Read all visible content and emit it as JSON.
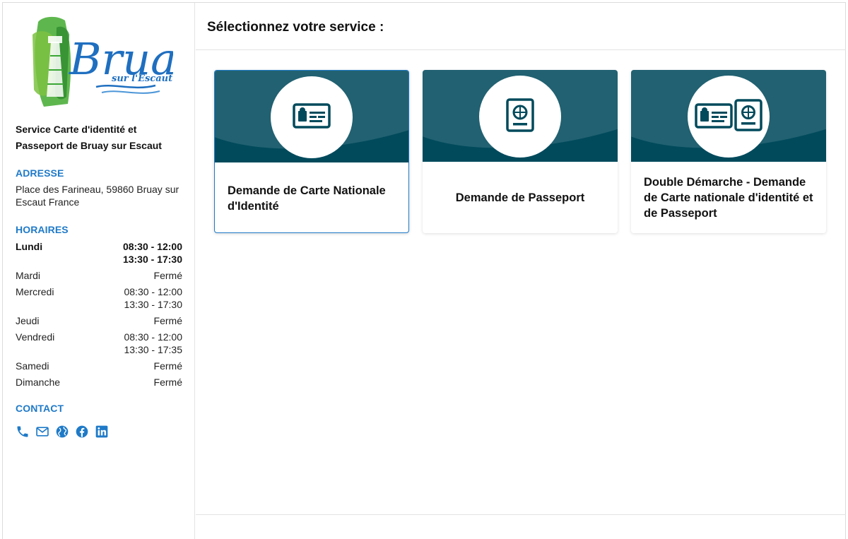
{
  "sidebar": {
    "logo": {
      "name": "Bruay",
      "subtitle": "sur l'Escaut"
    },
    "service_name": "Service Carte d'identité et Passeport de Bruay sur Escaut",
    "address_title": "ADRESSE",
    "address": "Place des Farineau, 59860 Bruay sur Escaut France",
    "hours_title": "HORAIRES",
    "hours": [
      {
        "day": "Lundi",
        "times": [
          "08:30 - 12:00",
          "13:30 - 17:30"
        ],
        "current": true
      },
      {
        "day": "Mardi",
        "times": [
          "Fermé"
        ]
      },
      {
        "day": "Mercredi",
        "times": [
          "08:30 - 12:00",
          "13:30 - 17:30"
        ]
      },
      {
        "day": "Jeudi",
        "times": [
          "Fermé"
        ]
      },
      {
        "day": "Vendredi",
        "times": [
          "08:30 - 12:00",
          "13:30 - 17:35"
        ]
      },
      {
        "day": "Samedi",
        "times": [
          "Fermé"
        ]
      },
      {
        "day": "Dimanche",
        "times": [
          "Fermé"
        ]
      }
    ],
    "contact_title": "CONTACT",
    "contact_icons": [
      "phone-icon",
      "mail-icon",
      "globe-icon",
      "facebook-icon",
      "linkedin-icon"
    ]
  },
  "main": {
    "title": "Sélectionnez votre service :",
    "cards": [
      {
        "label": "Demande de Carte Nationale d'Identité",
        "icon": "id-card-icon",
        "selected": true
      },
      {
        "label": "Demande de Passeport",
        "icon": "passport-icon",
        "selected": false
      },
      {
        "label": "Double Démarche - Demande de Carte nationale d'identité et de Passeport",
        "icon": "id-card-passport-icon",
        "selected": false
      }
    ]
  },
  "colors": {
    "accent": "#1f7ac8",
    "banner": "#004a5c",
    "logo_green": "#3aa635",
    "logo_blue": "#1f6fc0"
  }
}
